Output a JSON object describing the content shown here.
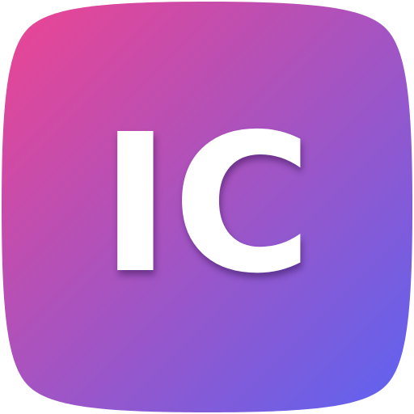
{
  "icon": {
    "label": "IC",
    "text_color": "#ffffff",
    "gradient": {
      "start": "#ee4491",
      "end": "#5c63f2"
    }
  }
}
